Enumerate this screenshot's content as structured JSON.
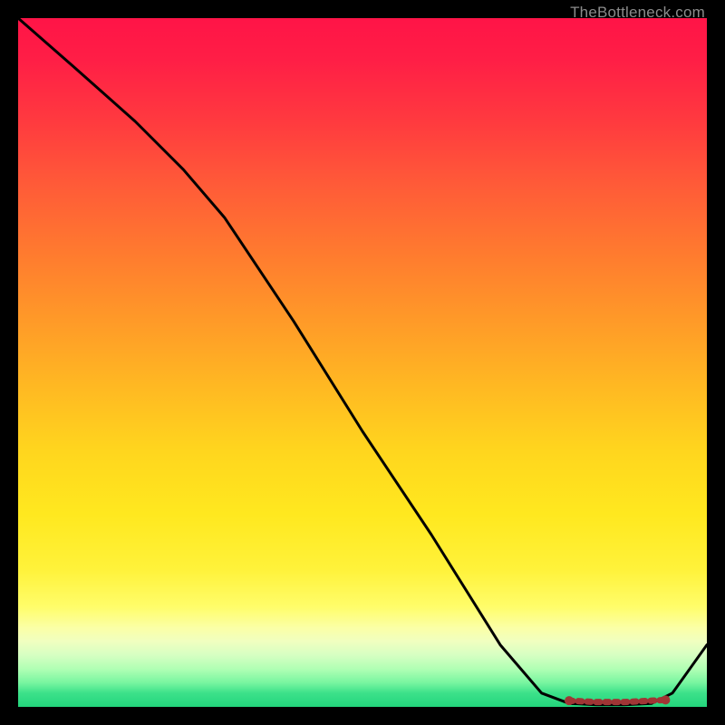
{
  "attribution": "TheBottleneck.com",
  "chart_data": {
    "type": "line",
    "title": "",
    "xlabel": "",
    "ylabel": "",
    "xlim": [
      0,
      100
    ],
    "ylim": [
      0,
      100
    ],
    "series": [
      {
        "name": "curve",
        "x": [
          0,
          8,
          17,
          24,
          30,
          40,
          50,
          60,
          70,
          76,
          80,
          84,
          88,
          92,
          95,
          100
        ],
        "values": [
          100,
          93,
          85,
          78,
          71,
          56,
          40,
          25,
          9,
          2,
          0.5,
          0.3,
          0.3,
          0.5,
          2,
          9
        ]
      }
    ],
    "markers": {
      "name": "optimum-band",
      "x": [
        80,
        82,
        84,
        86,
        88,
        90,
        92,
        94
      ],
      "values": [
        0.9,
        0.8,
        0.7,
        0.7,
        0.7,
        0.8,
        0.9,
        1.0
      ]
    },
    "colors": {
      "line": "#000000",
      "marker": "#a03535",
      "gradient_top": "#ff1447",
      "gradient_bottom": "#23d57c"
    }
  }
}
